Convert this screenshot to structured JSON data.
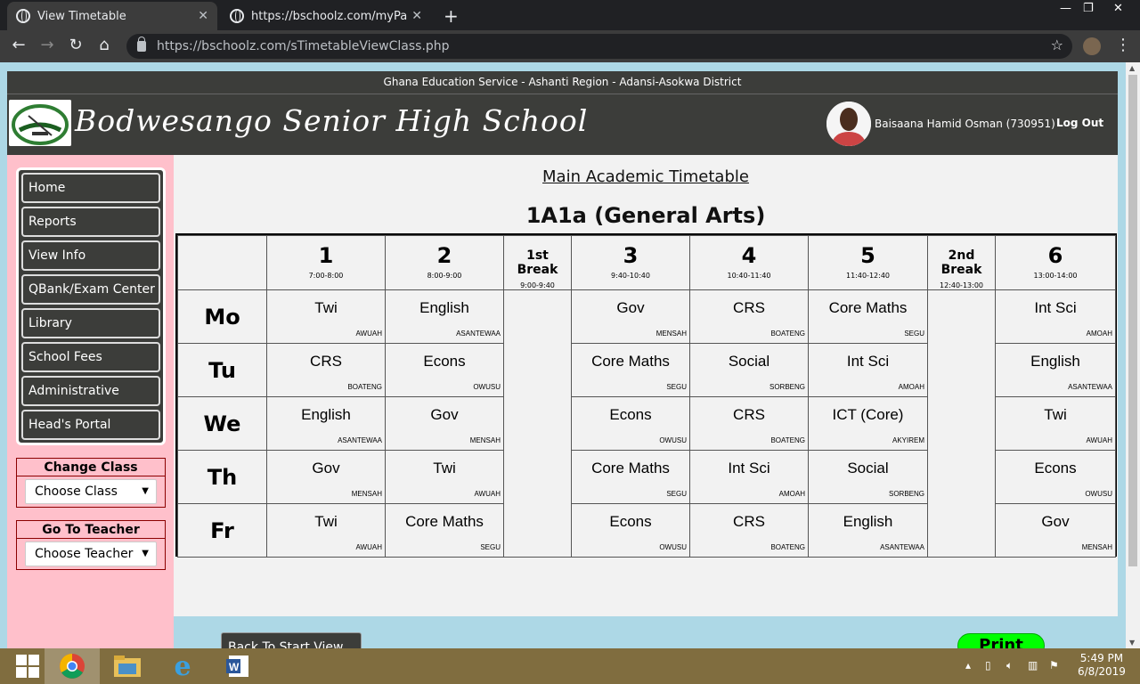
{
  "browser": {
    "tabs": [
      {
        "title": "View Timetable",
        "active": true
      },
      {
        "title": "https://bschoolz.com/myPageCh",
        "active": false
      }
    ],
    "url": "https://bschoolz.com/sTimetableViewClass.php"
  },
  "header": {
    "region": "Ghana Education Service - Ashanti Region - Adansi-Asokwa District",
    "school_name": "Bodwesango Senior High School",
    "user_name": "Baisaana Hamid Osman (730951)",
    "logout": "Log Out"
  },
  "sidebar": {
    "items": [
      {
        "label": "Home"
      },
      {
        "label": "Reports"
      },
      {
        "label": "View Info"
      },
      {
        "label": "QBank/Exam Center"
      },
      {
        "label": "Library"
      },
      {
        "label": "School Fees"
      },
      {
        "label": "Administrative"
      },
      {
        "label": "Head's Portal"
      }
    ],
    "change_class": {
      "title": "Change Class",
      "selected": "Choose Class"
    },
    "go_to_teacher": {
      "title": "Go To Teacher",
      "selected": "Choose Teacher"
    }
  },
  "timetable": {
    "title": "Main Academic Timetable",
    "class_name": "1A1a (General Arts)",
    "periods": [
      {
        "label": "1",
        "time": "7:00-8:00"
      },
      {
        "label": "2",
        "time": "8:00-9:00"
      },
      {
        "label": "1st Break",
        "time": "9:00-9:40",
        "is_break": true
      },
      {
        "label": "3",
        "time": "9:40-10:40"
      },
      {
        "label": "4",
        "time": "10:40-11:40"
      },
      {
        "label": "5",
        "time": "11:40-12:40"
      },
      {
        "label": "2nd Break",
        "time": "12:40-13:00",
        "is_break": true
      },
      {
        "label": "6",
        "time": "13:00-14:00"
      }
    ],
    "days": [
      {
        "day": "Mo",
        "lessons": [
          {
            "subject": "Twi",
            "teacher": "AWUAH"
          },
          {
            "subject": "English",
            "teacher": "ASANTEWAA"
          },
          {
            "subject": "Gov",
            "teacher": "MENSAH"
          },
          {
            "subject": "CRS",
            "teacher": "BOATENG"
          },
          {
            "subject": "Core Maths",
            "teacher": "SEGU"
          },
          {
            "subject": "Int Sci",
            "teacher": "AMOAH"
          }
        ]
      },
      {
        "day": "Tu",
        "lessons": [
          {
            "subject": "CRS",
            "teacher": "BOATENG"
          },
          {
            "subject": "Econs",
            "teacher": "OWUSU"
          },
          {
            "subject": "Core Maths",
            "teacher": "SEGU"
          },
          {
            "subject": "Social",
            "teacher": "SORBENG"
          },
          {
            "subject": "Int Sci",
            "teacher": "AMOAH"
          },
          {
            "subject": "English",
            "teacher": "ASANTEWAA"
          }
        ]
      },
      {
        "day": "We",
        "lessons": [
          {
            "subject": "English",
            "teacher": "ASANTEWAA"
          },
          {
            "subject": "Gov",
            "teacher": "MENSAH"
          },
          {
            "subject": "Econs",
            "teacher": "OWUSU"
          },
          {
            "subject": "CRS",
            "teacher": "BOATENG"
          },
          {
            "subject": "ICT (Core)",
            "teacher": "AKYIREM"
          },
          {
            "subject": "Twi",
            "teacher": "AWUAH"
          }
        ]
      },
      {
        "day": "Th",
        "lessons": [
          {
            "subject": "Gov",
            "teacher": "MENSAH"
          },
          {
            "subject": "Twi",
            "teacher": "AWUAH"
          },
          {
            "subject": "Core Maths",
            "teacher": "SEGU"
          },
          {
            "subject": "Int Sci",
            "teacher": "AMOAH"
          },
          {
            "subject": "Social",
            "teacher": "SORBENG"
          },
          {
            "subject": "Econs",
            "teacher": "OWUSU"
          }
        ]
      },
      {
        "day": "Fr",
        "lessons": [
          {
            "subject": "Twi",
            "teacher": "AWUAH"
          },
          {
            "subject": "Core Maths",
            "teacher": "SEGU"
          },
          {
            "subject": "Econs",
            "teacher": "OWUSU"
          },
          {
            "subject": "CRS",
            "teacher": "BOATENG"
          },
          {
            "subject": "English",
            "teacher": "ASANTEWAA"
          },
          {
            "subject": "Gov",
            "teacher": "MENSAH"
          }
        ]
      }
    ],
    "back_button": "Back To Start View",
    "print_button": "Print"
  },
  "taskbar": {
    "time": "5:49 PM",
    "date": "6/8/2019"
  },
  "colors": {
    "page_background": "#add8e6",
    "header_background": "#3c3d3a",
    "sidebar_background": "#ffc0cb",
    "print_button": "#00ff00"
  }
}
